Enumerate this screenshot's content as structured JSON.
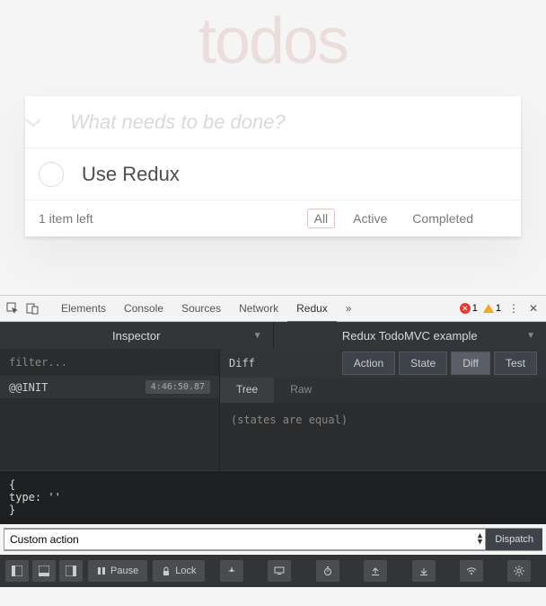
{
  "todo": {
    "title": "todos",
    "placeholder": "What needs to be done?",
    "items": [
      {
        "text": "Use Redux"
      }
    ],
    "count_text": "1 item left",
    "filters": {
      "all": "All",
      "active": "Active",
      "completed": "Completed"
    }
  },
  "devtools": {
    "tabs": [
      "Elements",
      "Console",
      "Sources",
      "Network",
      "Redux"
    ],
    "active_tab": "Redux",
    "errors": "1",
    "warnings": "1"
  },
  "redux": {
    "left_header": "Inspector",
    "right_header": "Redux TodoMVC example",
    "filter_placeholder": "filter...",
    "actions": [
      {
        "type": "@@INIT",
        "time": "4:46:50.87"
      }
    ],
    "view_label": "Diff",
    "view_tabs": [
      "Action",
      "State",
      "Diff",
      "Test"
    ],
    "active_view_tab": "Diff",
    "sub_tabs": [
      "Tree",
      "Raw"
    ],
    "active_sub_tab": "Tree",
    "diff_message": "(states are equal)",
    "code_preview": "{\ntype: ''\n}",
    "dispatch": {
      "select": "Custom action",
      "button": "Dispatch"
    },
    "toolbar": {
      "pause": "Pause",
      "lock": "Lock"
    }
  }
}
